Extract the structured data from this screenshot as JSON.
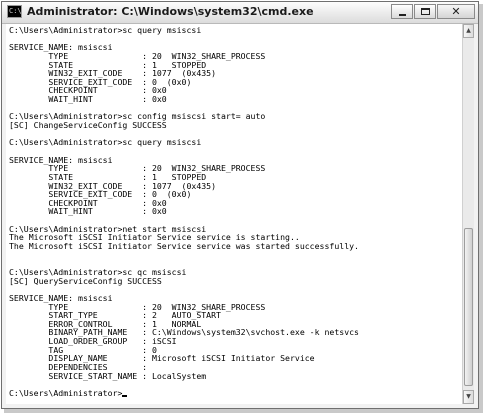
{
  "window": {
    "title": "Administrator: C:\\Windows\\system32\\cmd.exe",
    "icon": "console-icon",
    "controls": {
      "minimize": "minimize-icon",
      "maximize": "maximize-icon",
      "close": "✕"
    }
  },
  "console": {
    "background": "#ffffff",
    "foreground": "#000000",
    "lines": [
      "C:\\Users\\Administrator>sc query msiscsi",
      "",
      "SERVICE_NAME: msiscsi",
      "        TYPE               : 20  WIN32_SHARE_PROCESS",
      "        STATE              : 1   STOPPED",
      "        WIN32_EXIT_CODE    : 1077  (0x435)",
      "        SERVICE_EXIT_CODE  : 0  (0x0)",
      "        CHECKPOINT         : 0x0",
      "        WAIT_HINT          : 0x0",
      "",
      "C:\\Users\\Administrator>sc config msiscsi start= auto",
      "[SC] ChangeServiceConfig SUCCESS",
      "",
      "C:\\Users\\Administrator>sc query msiscsi",
      "",
      "SERVICE_NAME: msiscsi",
      "        TYPE               : 20  WIN32_SHARE_PROCESS",
      "        STATE              : 1   STOPPED",
      "        WIN32_EXIT_CODE    : 1077  (0x435)",
      "        SERVICE_EXIT_CODE  : 0  (0x0)",
      "        CHECKPOINT         : 0x0",
      "        WAIT_HINT          : 0x0",
      "",
      "C:\\Users\\Administrator>net start msiscsi",
      "The Microsoft iSCSI Initiator Service service is starting..",
      "The Microsoft iSCSI Initiator Service service was started successfully.",
      "",
      "",
      "C:\\Users\\Administrator>sc qc msiscsi",
      "[SC] QueryServiceConfig SUCCESS",
      "",
      "SERVICE_NAME: msiscsi",
      "        TYPE               : 20  WIN32_SHARE_PROCESS",
      "        START_TYPE         : 2   AUTO_START",
      "        ERROR_CONTROL      : 1   NORMAL",
      "        BINARY_PATH_NAME   : C:\\Windows\\system32\\svchost.exe -k netsvcs",
      "        LOAD_ORDER_GROUP   : iSCSI",
      "        TAG                : 0",
      "        DISPLAY_NAME       : Microsoft iSCSI Initiator Service",
      "        DEPENDENCIES       :",
      "        SERVICE_START_NAME : LocalSystem",
      "",
      "C:\\Users\\Administrator>"
    ]
  },
  "scrollbar": {
    "up_arrow": "▲",
    "down_arrow": "▼"
  }
}
